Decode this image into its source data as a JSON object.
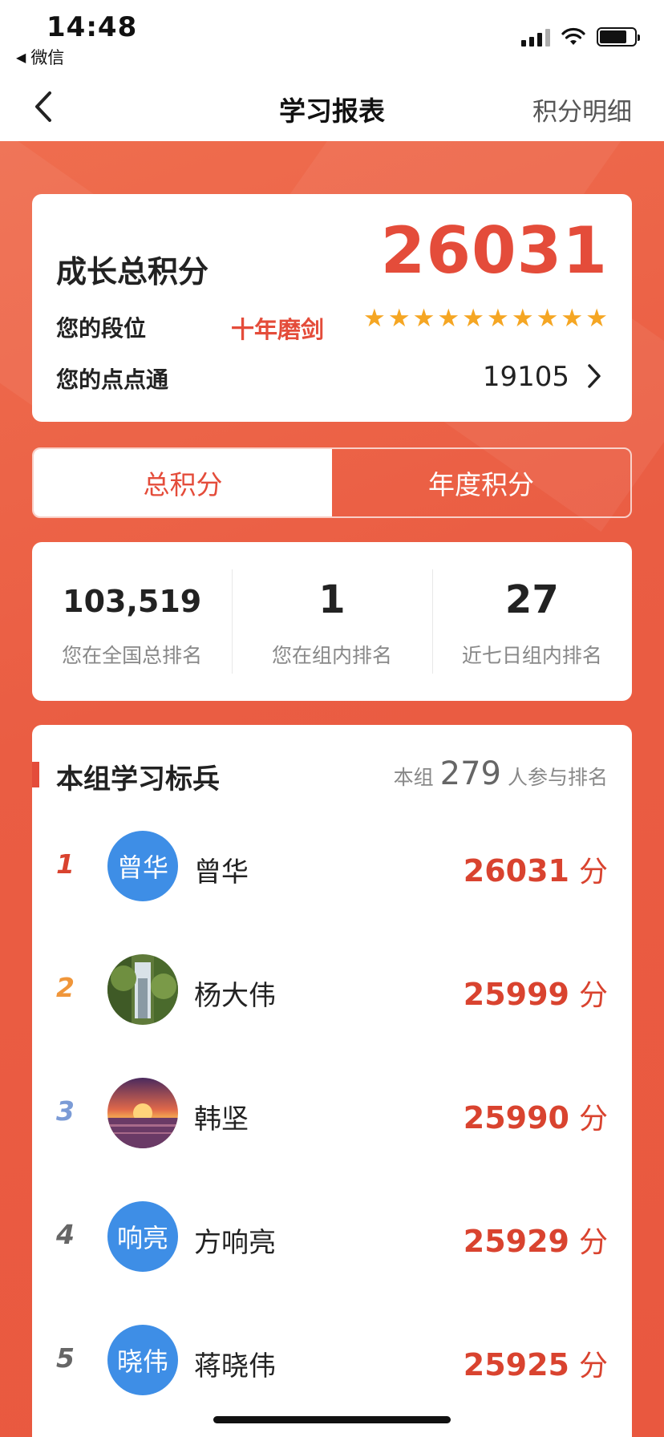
{
  "status_bar": {
    "time": "14:48",
    "back_app": "微信"
  },
  "nav": {
    "title": "学习报表",
    "right_link": "积分明细"
  },
  "score_card": {
    "title": "成长总积分",
    "total_score": "26031",
    "rank_label": "您的段位",
    "rank_name": "十年磨剑",
    "star_count": 10,
    "points_label": "您的点点通",
    "points_value": "19105"
  },
  "tabs": [
    {
      "label": "总积分",
      "active": true
    },
    {
      "label": "年度积分",
      "active": false
    }
  ],
  "stats": [
    {
      "value": "103,519",
      "label": "您在全国总排名"
    },
    {
      "value": "1",
      "label": "您在组内排名"
    },
    {
      "value": "27",
      "label": "近七日组内排名"
    }
  ],
  "leaderboard": {
    "title": "本组学习标兵",
    "meta_prefix": "本组",
    "participant_count": "279",
    "meta_suffix": "人参与排名",
    "unit": "分",
    "rows": [
      {
        "rank": "1",
        "name": "曾华",
        "avatar_text": "曾华",
        "avatar_type": "text",
        "score": "26031",
        "rank_color": "#d9432f"
      },
      {
        "rank": "2",
        "name": "杨大伟",
        "avatar_text": "",
        "avatar_type": "forest-photo",
        "score": "25999",
        "rank_color": "#f0963a"
      },
      {
        "rank": "3",
        "name": "韩坚",
        "avatar_text": "",
        "avatar_type": "sunset-photo",
        "score": "25990",
        "rank_color": "#7b9bd6"
      },
      {
        "rank": "4",
        "name": "方响亮",
        "avatar_text": "响亮",
        "avatar_type": "text",
        "score": "25929",
        "rank_color": "#666666"
      },
      {
        "rank": "5",
        "name": "蒋晓伟",
        "avatar_text": "晓伟",
        "avatar_type": "text",
        "score": "25925",
        "rank_color": "#666666"
      }
    ]
  },
  "colors": {
    "accent": "#e44c3a",
    "avatar_blue": "#3e8ee6",
    "star": "#f5a623"
  }
}
